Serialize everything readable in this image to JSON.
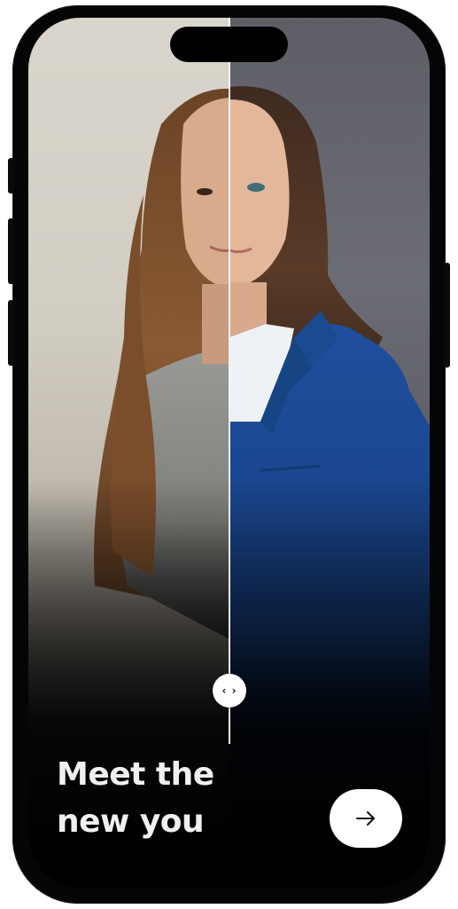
{
  "onboarding": {
    "headline_line1": "Meet the",
    "headline_line2": "new you",
    "next_icon": "arrow-right-icon",
    "slider_icon": "chevrons-left-right-icon",
    "slider_glyph": "‹ ›"
  },
  "colors": {
    "headline": "#f2f0ee",
    "button_background": "#ffffff",
    "divider": "#f3f3f3",
    "blazer": "#1e4f9e"
  }
}
